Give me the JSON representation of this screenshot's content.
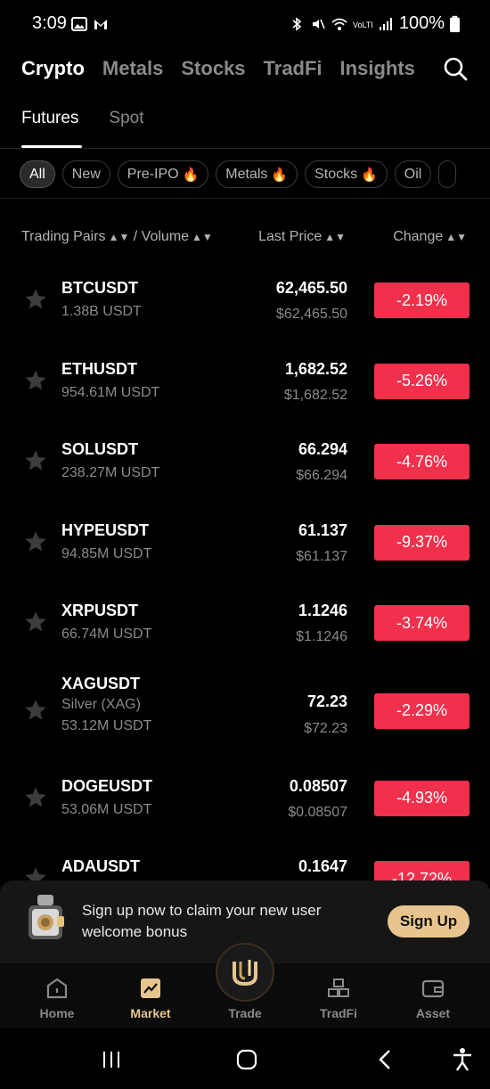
{
  "status_bar": {
    "time": "3:09",
    "battery": "100%",
    "left_icons": [
      "image-icon",
      "gmail-icon"
    ],
    "right_icons": [
      "bluetooth-icon",
      "mute-icon",
      "wifi-icon",
      "volte-icon",
      "signal-icon",
      "battery-icon"
    ]
  },
  "top_tabs": [
    "Crypto",
    "Metals",
    "Stocks",
    "TradFi",
    "Insights"
  ],
  "top_tab_active": "Crypto",
  "sub_tabs": [
    "Futures",
    "Spot"
  ],
  "sub_tab_active": "Futures",
  "filter_chips": [
    {
      "label": "All",
      "active": true,
      "hot": false
    },
    {
      "label": "New",
      "active": false,
      "hot": false
    },
    {
      "label": "Pre-IPO",
      "active": false,
      "hot": true
    },
    {
      "label": "Metals",
      "active": false,
      "hot": true
    },
    {
      "label": "Stocks",
      "active": false,
      "hot": true
    },
    {
      "label": "Oil",
      "active": false,
      "hot": false
    }
  ],
  "columns": {
    "pairs": "Trading Pairs",
    "volume": "/ Volume",
    "last_price": "Last Price",
    "change": "Change"
  },
  "rows": [
    {
      "pair": "BTCUSDT",
      "sub": "",
      "volume": "1.38B USDT",
      "price": "62,465.50",
      "usd": "$62,465.50",
      "change": "-2.19%"
    },
    {
      "pair": "ETHUSDT",
      "sub": "",
      "volume": "954.61M USDT",
      "price": "1,682.52",
      "usd": "$1,682.52",
      "change": "-5.26%"
    },
    {
      "pair": "SOLUSDT",
      "sub": "",
      "volume": "238.27M USDT",
      "price": "66.294",
      "usd": "$66.294",
      "change": "-4.76%"
    },
    {
      "pair": "HYPEUSDT",
      "sub": "",
      "volume": "94.85M USDT",
      "price": "61.137",
      "usd": "$61.137",
      "change": "-9.37%"
    },
    {
      "pair": "XRPUSDT",
      "sub": "",
      "volume": "66.74M USDT",
      "price": "1.1246",
      "usd": "$1.1246",
      "change": "-3.74%"
    },
    {
      "pair": "XAGUSDT",
      "sub": "Silver (XAG)",
      "volume": "53.12M USDT",
      "price": "72.23",
      "usd": "$72.23",
      "change": "-2.29%"
    },
    {
      "pair": "DOGEUSDT",
      "sub": "",
      "volume": "53.06M USDT",
      "price": "0.08507",
      "usd": "$0.08507",
      "change": "-4.93%"
    },
    {
      "pair": "ADAUSDT",
      "sub": "",
      "volume": "",
      "price": "0.1647",
      "usd": "",
      "change": "-12.72%"
    }
  ],
  "promo": {
    "text": "Sign up now to claim your new user welcome bonus",
    "button": "Sign Up"
  },
  "bottom_nav": [
    {
      "label": "Home",
      "icon": "home-icon",
      "active": false
    },
    {
      "label": "Market",
      "icon": "market-chart-icon",
      "active": true
    },
    {
      "label": "Trade",
      "icon": "trade-logo-icon",
      "active": false
    },
    {
      "label": "TradFi",
      "icon": "tradfi-blocks-icon",
      "active": false
    },
    {
      "label": "Asset",
      "icon": "wallet-icon",
      "active": false
    }
  ],
  "colors": {
    "background": "#000000",
    "negative": "#f1304c",
    "accent": "#e8c58f",
    "muted_text": "#8a8a8a"
  }
}
